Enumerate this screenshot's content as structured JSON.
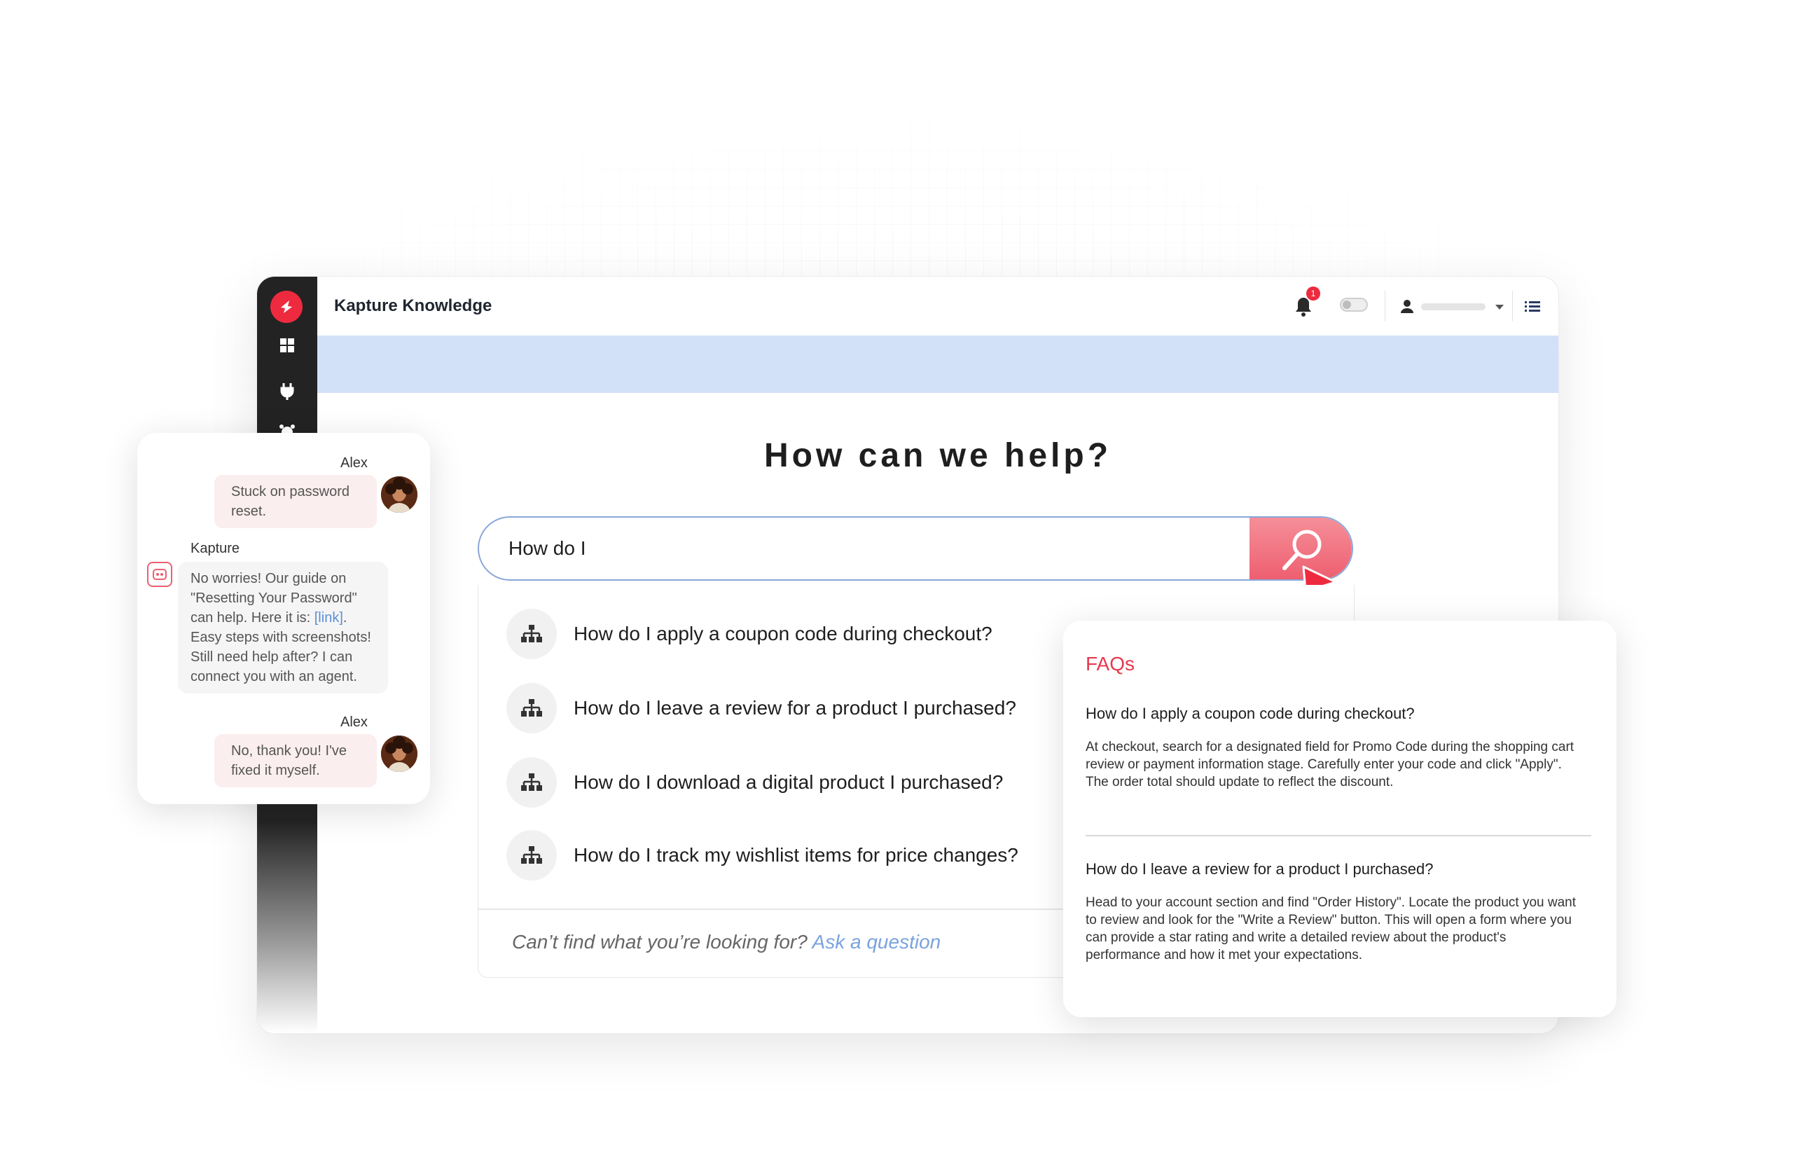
{
  "app": {
    "title": "Kapture Knowledge",
    "notification_count": "1"
  },
  "hero": {
    "title": "How can we help?"
  },
  "search": {
    "value": "How do I"
  },
  "suggestions": [
    "How do I apply a coupon code during checkout?",
    "How do I leave a review for a product I purchased?",
    "How do I download a digital product I purchased?",
    "How do I track my wishlist items for price changes?"
  ],
  "footer": {
    "prompt": "Can’t find what you’re looking for?",
    "link": "Ask a question"
  },
  "chat": {
    "messages": [
      {
        "sender": "Alex",
        "text": "Stuck on password reset."
      },
      {
        "sender": "Kapture",
        "text_before": "No worries! Our guide on \"Resetting Your Password\" can help. Here it is: ",
        "link": "[link]",
        "text_after": ". Easy steps with screenshots! Still need help after? I can connect you with an agent."
      },
      {
        "sender": "Alex",
        "text": "No, thank you! I've fixed it myself."
      }
    ]
  },
  "faq": {
    "title": "FAQs",
    "items": [
      {
        "question": "How do I apply a coupon code during checkout?",
        "answer": "At checkout, search for a designated field for Promo Code during the shopping cart review or payment information stage.  Carefully enter your code and click \"Apply\". The order total should update to reflect the discount."
      },
      {
        "question": "How do I leave a review for a product I purchased?",
        "answer": "Head to your account section and find \"Order History\". Locate the product you want to review and look for the \"Write a Review\" button. This will open a form where you can provide a star rating and write a detailed review about the product's performance and how it met your expectations."
      }
    ]
  },
  "colors": {
    "brand": "#ee2a3f",
    "banner": "#d3e1f8",
    "search_button": "#ee5f70",
    "link": "#7aa3dd"
  }
}
